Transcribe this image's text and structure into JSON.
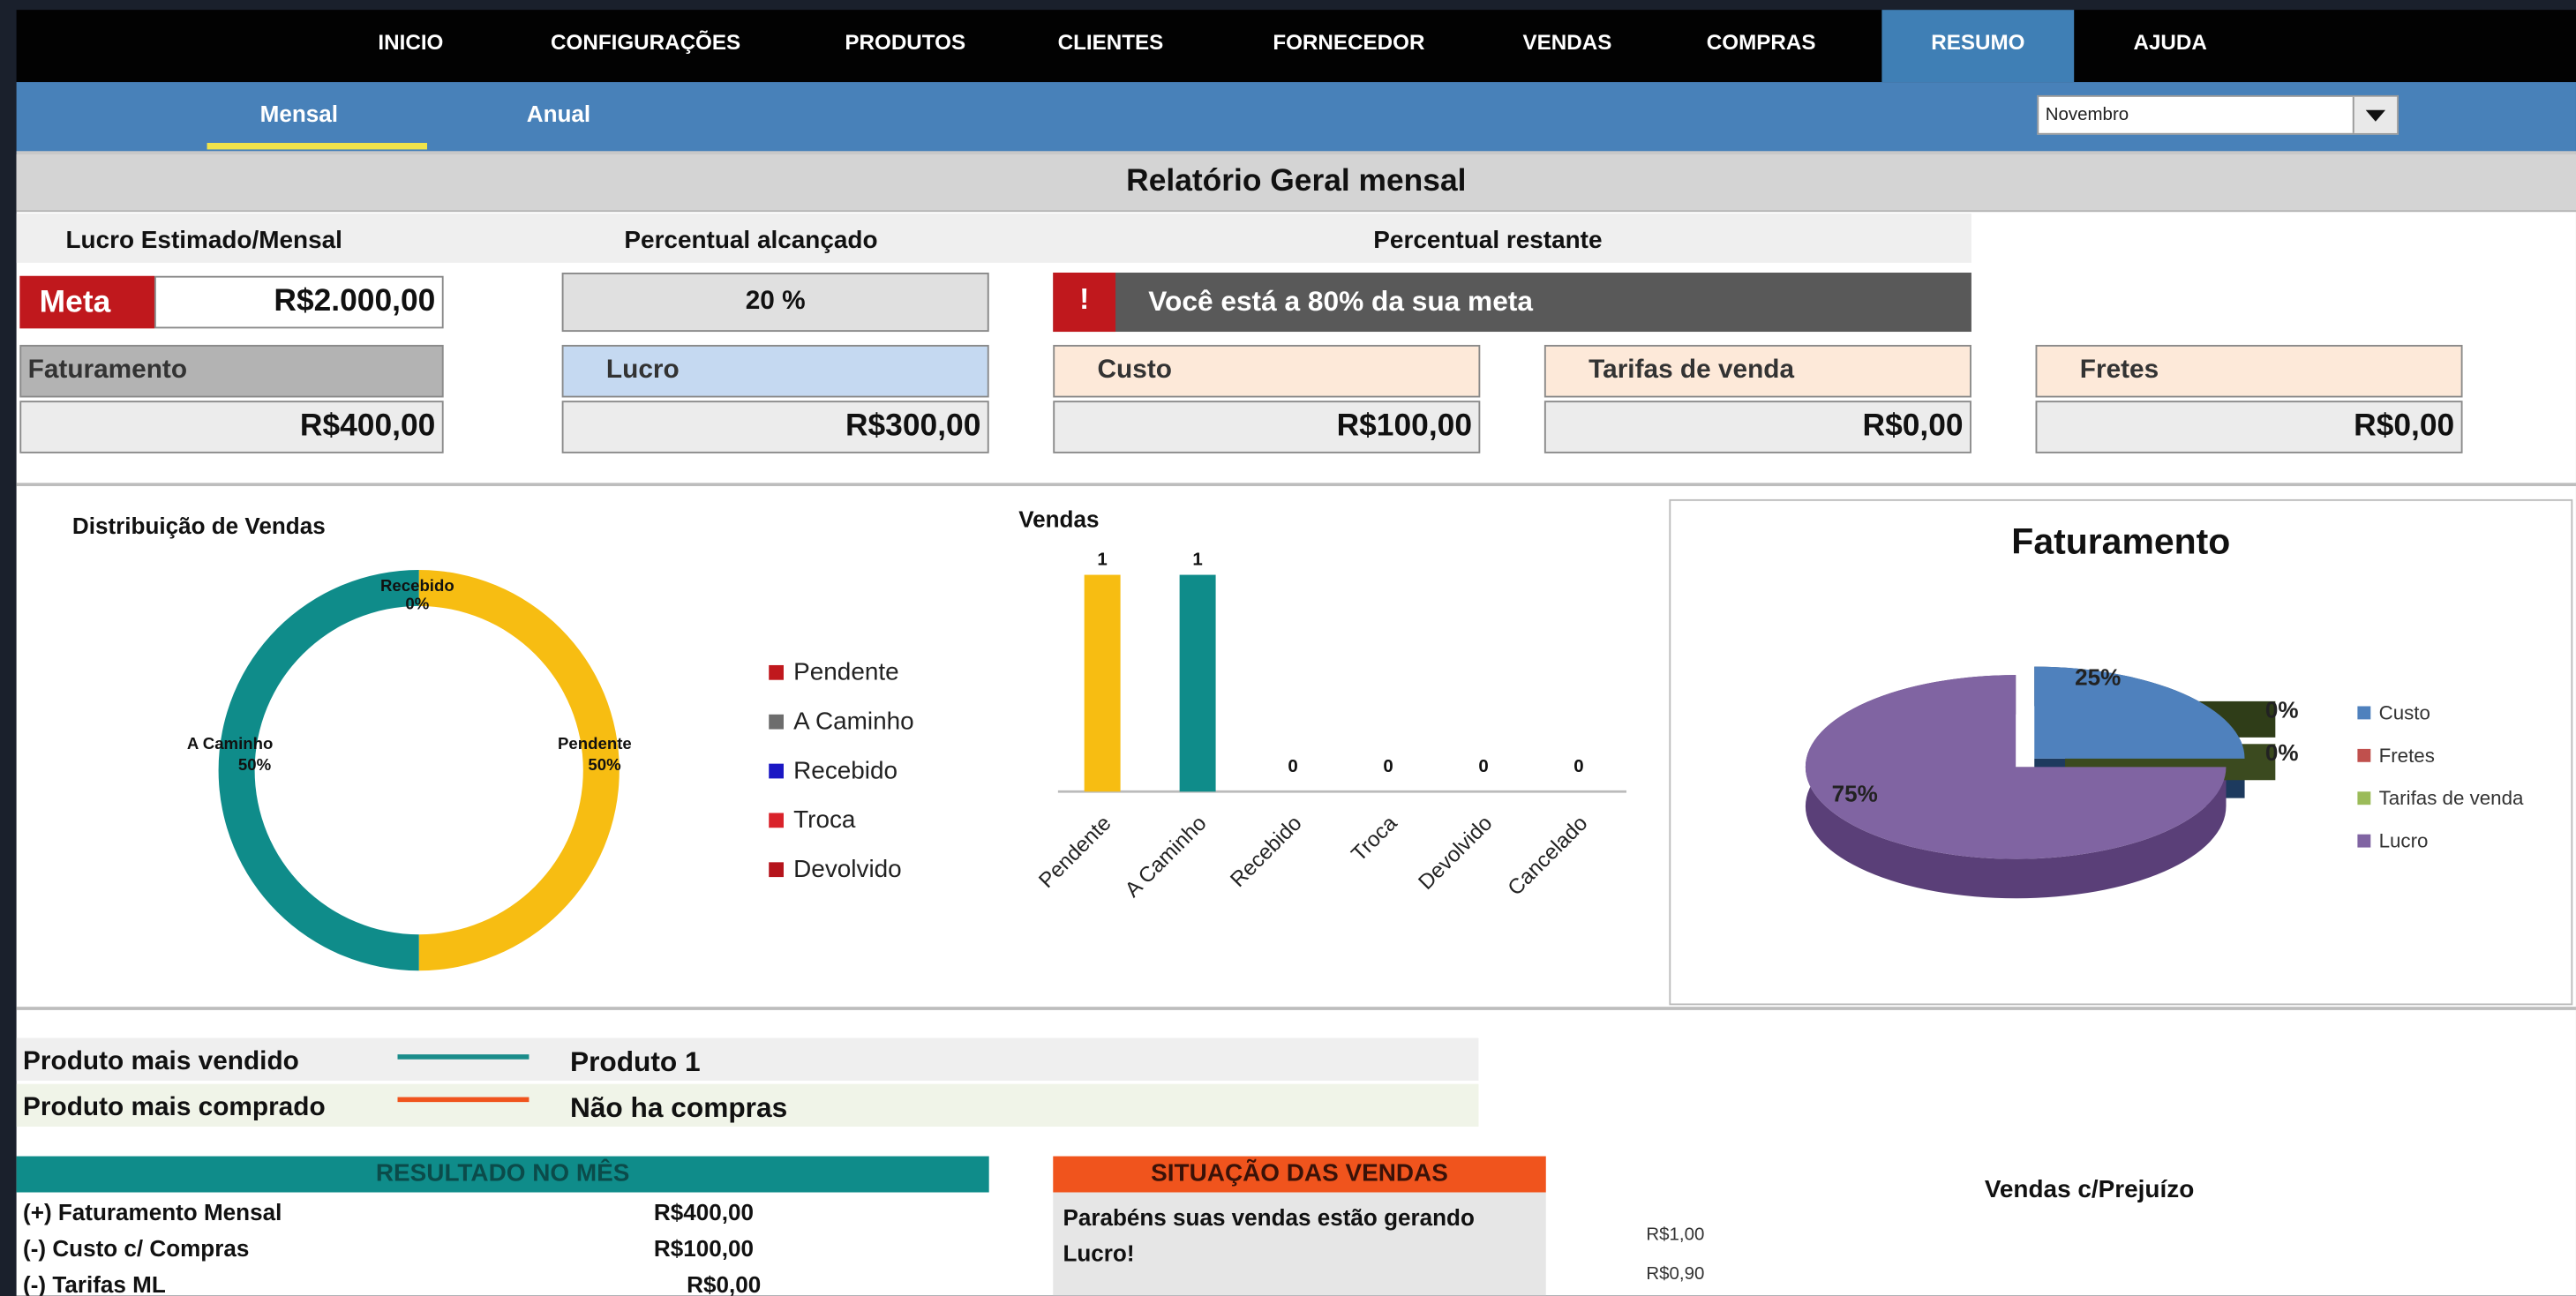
{
  "nav": {
    "items": [
      "INICIO",
      "CONFIGURAÇÕES",
      "PRODUTOS",
      "CLIENTES",
      "FORNECEDOR",
      "VENDAS",
      "COMPRAS",
      "RESUMO",
      "AJUDA"
    ],
    "active": "RESUMO"
  },
  "subnav": {
    "tabs": [
      "Mensal",
      "Anual"
    ],
    "active": "Mensal",
    "month": "Novembro"
  },
  "report": {
    "title": "Relatório Geral mensal",
    "lucro_estimado_label": "Lucro Estimado/Mensal",
    "meta_label": "Meta",
    "meta_value": "R$2.000,00",
    "percentual_alcancado_label": "Percentual alcançado",
    "percentual_alcancado_value": "20 %",
    "percentual_restante_label": "Percentual restante",
    "alert_icon": "!",
    "alert_text": "Você está a 80% da sua meta"
  },
  "kpis": {
    "faturamento": {
      "label": "Faturamento",
      "value": "R$400,00"
    },
    "lucro": {
      "label": "Lucro",
      "value": "R$300,00"
    },
    "custo": {
      "label": "Custo",
      "value": "R$100,00"
    },
    "tarifas": {
      "label": "Tarifas de venda",
      "value": "R$0,00"
    },
    "fretes": {
      "label": "Fretes",
      "value": "R$0,00"
    }
  },
  "colors": {
    "nav_bg": "#020202",
    "accent_blue": "#4881b9",
    "meta_red": "#c0181d",
    "teal": "#0f8c8a",
    "yellow": "#f7bd12",
    "orange": "#f0541d"
  },
  "chart_data": [
    {
      "type": "pie",
      "title": "Distribuição de Vendas",
      "categories": [
        "Pendente",
        "A Caminho",
        "Recebido",
        "Troca",
        "Devolvido"
      ],
      "values": [
        1,
        1,
        0,
        0,
        0
      ],
      "labels": [
        {
          "name": "Pendente",
          "pct": "50%"
        },
        {
          "name": "A Caminho",
          "pct": "50%"
        },
        {
          "name": "Recebido",
          "pct": "0%"
        }
      ],
      "colors": [
        "#f7bd12",
        "#0f8c8a",
        "#1a17c4",
        "#d9222a",
        "#b5141c"
      ],
      "legend_colors": [
        "#c0181d",
        "#6d6d6d",
        "#1a17c4",
        "#d9222a",
        "#b5141c"
      ],
      "legend": "right"
    },
    {
      "type": "bar",
      "title": "Vendas",
      "categories": [
        "Pendente",
        "A Caminho",
        "Recebido",
        "Troca",
        "Devolvido",
        "Cancelado"
      ],
      "values": [
        1,
        1,
        0,
        0,
        0,
        0
      ],
      "colors": [
        "#f7bd12",
        "#0f8c8a",
        "#0f8c8a",
        "#0f8c8a",
        "#0f8c8a",
        "#0f8c8a"
      ],
      "ylim": [
        0,
        1
      ]
    },
    {
      "type": "pie",
      "title": "Faturamento",
      "categories": [
        "Custo",
        "Fretes",
        "Tarifas de venda",
        "Lucro"
      ],
      "values": [
        25,
        0,
        0,
        75
      ],
      "labels": [
        "25%",
        "0%",
        "0%",
        "75%"
      ],
      "colors": [
        "#4f81bd",
        "#c0504d",
        "#9bbb59",
        "#8064a2"
      ],
      "legend": "right"
    },
    {
      "type": "line",
      "title": "Vendas c/Prejuízo",
      "ytick_labels": [
        "R$1,00",
        "R$0,90"
      ]
    }
  ],
  "bottom": {
    "mais_vendido_label": "Produto mais vendido",
    "mais_vendido_value": "Produto 1",
    "mais_comprado_label": "Produto mais comprado",
    "mais_comprado_value": "Não ha compras",
    "resultado_title": "RESULTADO NO MÊS",
    "resultado_rows": [
      {
        "label": "(+) Faturamento Mensal",
        "value": "R$400,00"
      },
      {
        "label": "(-) Custo c/ Compras",
        "value": "R$100,00"
      },
      {
        "label": "(-) Tarifas ML",
        "value": "R$0,00"
      }
    ],
    "situacao_title": "SITUAÇÃO DAS VENDAS",
    "situacao_text": "Parabéns suas vendas estão gerando Lucro!"
  }
}
